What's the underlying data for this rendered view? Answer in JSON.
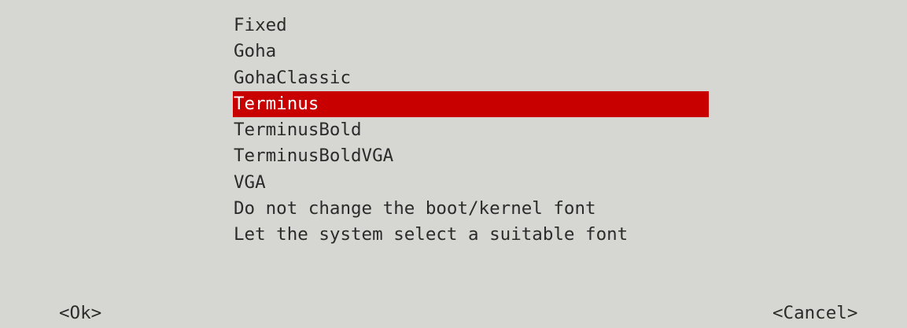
{
  "menu": {
    "items": [
      {
        "label": "Fixed",
        "selected": false
      },
      {
        "label": "Goha",
        "selected": false
      },
      {
        "label": "GohaClassic",
        "selected": false
      },
      {
        "label": "Terminus",
        "selected": true
      },
      {
        "label": "TerminusBold",
        "selected": false
      },
      {
        "label": "TerminusBoldVGA",
        "selected": false
      },
      {
        "label": "VGA",
        "selected": false
      },
      {
        "label": "Do not change the boot/kernel font",
        "selected": false
      },
      {
        "label": "Let the system select a suitable font",
        "selected": false
      }
    ],
    "highlight_color": "#c80000",
    "background_color": "#d6d6d2"
  },
  "buttons": {
    "ok_label": "<Ok>",
    "cancel_label": "<Cancel>"
  }
}
